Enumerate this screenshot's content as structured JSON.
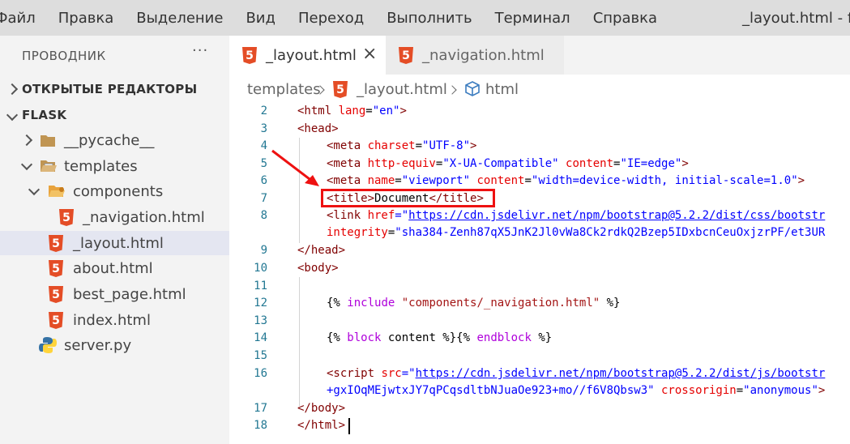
{
  "menu": {
    "items": [
      "Файл",
      "Правка",
      "Выделение",
      "Вид",
      "Переход",
      "Выполнить",
      "Терминал",
      "Справка"
    ],
    "window_title": "_layout.html - fla"
  },
  "sidebar": {
    "title": "ПРОВОДНИК",
    "more": "···",
    "open_editors": "ОТКРЫТЫЕ РЕДАКТОРЫ",
    "project": "FLASK",
    "tree": [
      {
        "label": "__pycache__",
        "icon": "folder-icon"
      },
      {
        "label": "templates",
        "icon": "folder-open-icon"
      },
      {
        "label": "components",
        "icon": "folder-open-icon"
      },
      {
        "label": "_navigation.html",
        "icon": "html5-icon"
      },
      {
        "label": "_layout.html",
        "icon": "html5-icon"
      },
      {
        "label": "about.html",
        "icon": "html5-icon"
      },
      {
        "label": "best_page.html",
        "icon": "html5-icon"
      },
      {
        "label": "index.html",
        "icon": "html5-icon"
      },
      {
        "label": "server.py",
        "icon": "python-icon"
      }
    ]
  },
  "tabs": [
    {
      "label": "_layout.html",
      "active": true
    },
    {
      "label": "_navigation.html",
      "active": false
    }
  ],
  "breadcrumb": [
    "templates",
    "_layout.html",
    "html"
  ],
  "editor": {
    "line_numbers": [
      "2",
      "3",
      "4",
      "5",
      "6",
      "7",
      "8",
      "9",
      "10",
      "11",
      "12",
      "13",
      "14",
      "15",
      "16",
      "17",
      "18"
    ],
    "tokens": {
      "l2": [
        "<html ",
        "lang",
        "=",
        "\"en\"",
        ">"
      ],
      "l3": "<head>",
      "l4": [
        "<meta ",
        "charset",
        "=",
        "\"UTF-8\"",
        ">"
      ],
      "l5": [
        "<meta ",
        "http-equiv",
        "=",
        "\"X-UA-Compatible\"",
        " content",
        "=",
        "\"IE=edge\"",
        ">"
      ],
      "l6": [
        "<meta ",
        "name",
        "=",
        "\"viewport\"",
        " content",
        "=",
        "\"width=device-width, initial-scale=1.0\"",
        ">"
      ],
      "l7": [
        "<title>",
        "Document",
        "</title>"
      ],
      "l8": [
        "<link ",
        "href",
        "=\"",
        "https://cdn.jsdelivr.net/npm/bootstrap@5.2.2/dist/css/bootstr"
      ],
      "l8b": [
        "integrity",
        "=",
        "\"sha384-Zenh87qX5JnK2Jl0vWa8Ck2rdkQ2Bzep5IDxbcnCeuOxjzrPF/et3UR"
      ],
      "l9": "</head>",
      "l10": "<body>",
      "l12": [
        "{% ",
        "include",
        " \"components/_navigation.html\"",
        " %}"
      ],
      "l14": [
        "{% ",
        "block",
        " content %}{% ",
        "endblock",
        " %}"
      ],
      "l16": [
        "<script ",
        "src",
        "=\"",
        "https://cdn.jsdelivr.net/npm/bootstrap@5.2.2/dist/js/bootstr"
      ],
      "l16b": [
        "+gxIOqMEjwtxJY7qPCqsdltbNJuaOe923+mo//f6V8Qbsw3\"",
        " crossorigin",
        "=",
        "\"anonymous\"",
        ">"
      ],
      "l17": "</body>",
      "l18": "</html>"
    }
  },
  "colors": {
    "annotation": "#e11111",
    "html5": "#e44d26"
  }
}
